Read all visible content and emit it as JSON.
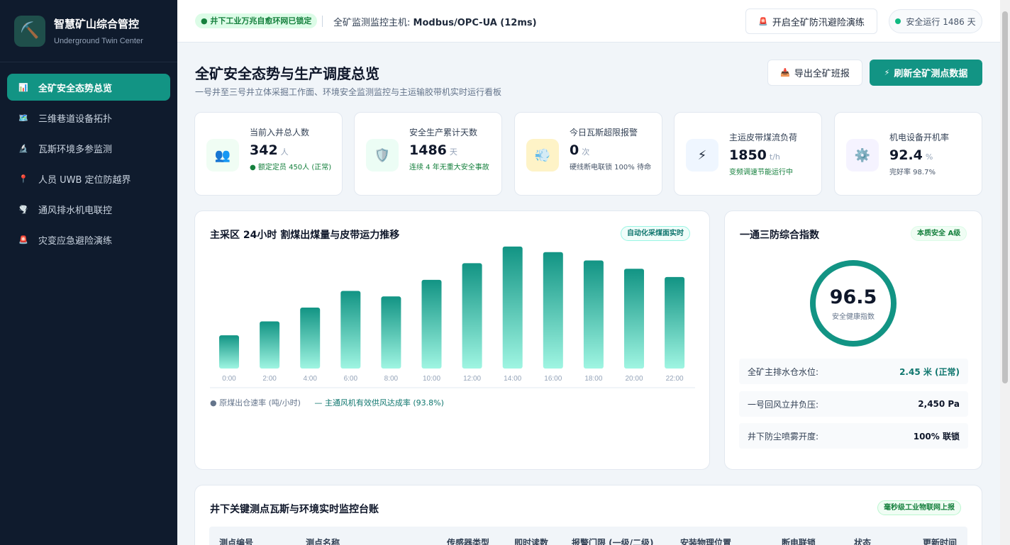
{
  "brand": {
    "title": "智慧矿山综合管控",
    "subtitle": "Underground Twin Center",
    "logo_icon": "pickaxe-icon"
  },
  "sidebar": {
    "items": [
      {
        "label": "全矿安全态势总览",
        "icon": "bar-chart-icon",
        "active": true
      },
      {
        "label": "三维巷道设备拓扑",
        "icon": "map-icon"
      },
      {
        "label": "瓦斯环境多参监测",
        "icon": "microscope-icon"
      },
      {
        "label": "人员 UWB 定位防越界",
        "icon": "location-pin-icon"
      },
      {
        "label": "通风排水机电联控",
        "icon": "funnel-icon"
      },
      {
        "label": "灾变应急避险演练",
        "icon": "alarm-light-icon"
      }
    ]
  },
  "topbar": {
    "network_badge": "● 井下工业万兆自愈环网已锁定",
    "host_label": "全矿监测监控主机:",
    "host_value": "Modbus/OPC-UA (12ms)",
    "drill_button": "开启全矿防汛避险演练",
    "status_pill": "安全运行 1486 天"
  },
  "header": {
    "title": "全矿安全态势与生产调度总览",
    "subtitle": "一号井至三号井立体采掘工作面、环境安全监测监控与主运输胶带机实时运行看板",
    "export_button": "导出全矿班报",
    "refresh_button": "刷新全矿测点数据"
  },
  "kpis": [
    {
      "label": "当前入井总人数",
      "value": "342",
      "unit": "人",
      "note": "● 额定定员 450人 (正常)",
      "icon": "people-icon",
      "icon_bg": "#f0fdf4",
      "note_color": "#15803d"
    },
    {
      "label": "安全生产累计天数",
      "value": "1486",
      "unit": "天",
      "note": "连续 4 年无重大安全事故",
      "icon": "shield-icon",
      "icon_bg": "#ecfdf5",
      "note_color": "#15803d"
    },
    {
      "label": "今日瓦斯超限报警",
      "value": "0",
      "unit": "次",
      "note": "硬线断电联锁 100% 待命",
      "icon": "gas-cloud-icon",
      "icon_bg": "#fef3c7",
      "note_color": "#475569"
    },
    {
      "label": "主运皮带煤流负荷",
      "value": "1850",
      "unit": "t/h",
      "note": "变频调速节能运行中",
      "icon": "lightning-icon",
      "icon_bg": "#eff6ff",
      "note_color": "#15803d"
    },
    {
      "label": "机电设备开机率",
      "value": "92.4",
      "unit": "%",
      "note": "完好率 98.7%",
      "icon": "gear-icon",
      "icon_bg": "#f5f3ff",
      "note_color": "#475569"
    }
  ],
  "chart_card": {
    "title": "主采区 24小时 割煤出煤量与皮带运力推移",
    "chip": "自动化采煤面实时",
    "legend_bar": "● 原煤出仓速率 (吨/小时)",
    "legend_line": "— 主通风机有效供风达成率 (93.8%)"
  },
  "chart_data": {
    "type": "bar",
    "categories": [
      "0:00",
      "2:00",
      "4:00",
      "6:00",
      "8:00",
      "10:00",
      "12:00",
      "14:00",
      "16:00",
      "18:00",
      "20:00",
      "22:00"
    ],
    "values": [
      48,
      68,
      88,
      112,
      104,
      128,
      152,
      176,
      168,
      156,
      144,
      132
    ],
    "series": [
      {
        "name": "原煤出仓速率 (吨/小时)",
        "values": [
          48,
          68,
          88,
          112,
          104,
          128,
          152,
          176,
          168,
          156,
          144,
          132
        ]
      }
    ],
    "title": "主采区 24小时 割煤出煤量与皮带运力推移",
    "xlabel": "",
    "ylabel": "",
    "ylim": [
      0,
      180
    ],
    "grid": false,
    "legend": "bottom-left",
    "colors": {
      "bar_top": "#129484",
      "bar_bottom": "#9ff5e2"
    }
  },
  "index_card": {
    "title": "一通三防综合指数",
    "chip": "本质安全 A级",
    "score": "96.5",
    "score_label": "安全健康指数",
    "metrics": [
      {
        "label": "全矿主排水仓水位:",
        "value": "2.45 米 (正常)",
        "color": "#0f766e"
      },
      {
        "label": "一号回风立井负压:",
        "value": "2,450 Pa",
        "color": "#0f172a"
      },
      {
        "label": "井下防尘喷雾开度:",
        "value": "100% 联锁",
        "color": "#0f172a"
      }
    ]
  },
  "table_card": {
    "title": "井下关键测点瓦斯与环境实时监控台账",
    "chip": "毫秒级工业物联网上报",
    "columns": [
      "测点编号",
      "测点名称",
      "传感器类型",
      "即时读数",
      "报警门限 (一级/二级)",
      "安装物理位置",
      "断电联锁",
      "状态",
      "更新时间"
    ]
  },
  "colors": {
    "accent": "#129484",
    "sidebar_bg": "#0f1b2d"
  }
}
